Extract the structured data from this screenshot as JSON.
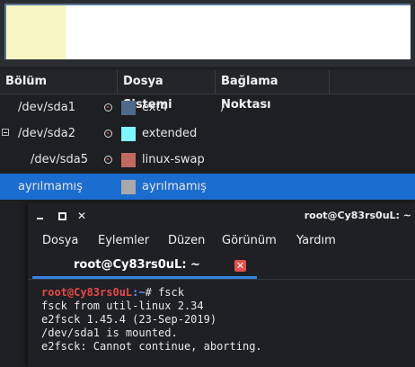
{
  "partition_bar": {
    "segment_color": "#f7f5c4"
  },
  "columns": {
    "partition": "Bölüm",
    "filesystem": "Dosya Sistemi",
    "mountpoint": "Bağlama Noktası"
  },
  "rows": [
    {
      "device": "/dev/sda1",
      "filesystem": "ext4",
      "mountpoint": "/",
      "swatch": "#4e6a88",
      "mounted": true
    },
    {
      "device": "/dev/sda2",
      "filesystem": "extended",
      "mountpoint": "",
      "swatch": "#7ef7ff",
      "mounted": true,
      "expander": "minus"
    },
    {
      "device": "/dev/sda5",
      "filesystem": "linux-swap",
      "mountpoint": "",
      "swatch": "#c26a5f",
      "mounted": true
    },
    {
      "device": "ayrılmamış",
      "filesystem": "ayrılmamış",
      "mountpoint": "",
      "swatch": "#a9a9a9",
      "mounted": false,
      "selected": true
    }
  ],
  "terminal": {
    "title": "root@Cy83rs0uL: ~",
    "menu": [
      "Dosya",
      "Eylemler",
      "Düzen",
      "Görünüm",
      "Yardım"
    ],
    "tab_label": "root@Cy83rs0uL: ~",
    "prompt_user": "root@Cy83rs0uL",
    "prompt_path": ":~",
    "prompt_symbol": "# ",
    "command": "fsck",
    "output": [
      "fsck from util-linux 2.34",
      "e2fsck 1.45.4 (23-Sep-2019)",
      "/dev/sda1 is mounted.",
      "e2fsck: Cannot continue, aborting."
    ]
  },
  "colors": {
    "selection": "#1c6dd0",
    "tab_accent": "#3584e4",
    "close_button": "#e4504a",
    "prompt_user": "#e8484a",
    "prompt_path": "#5b9cff"
  }
}
